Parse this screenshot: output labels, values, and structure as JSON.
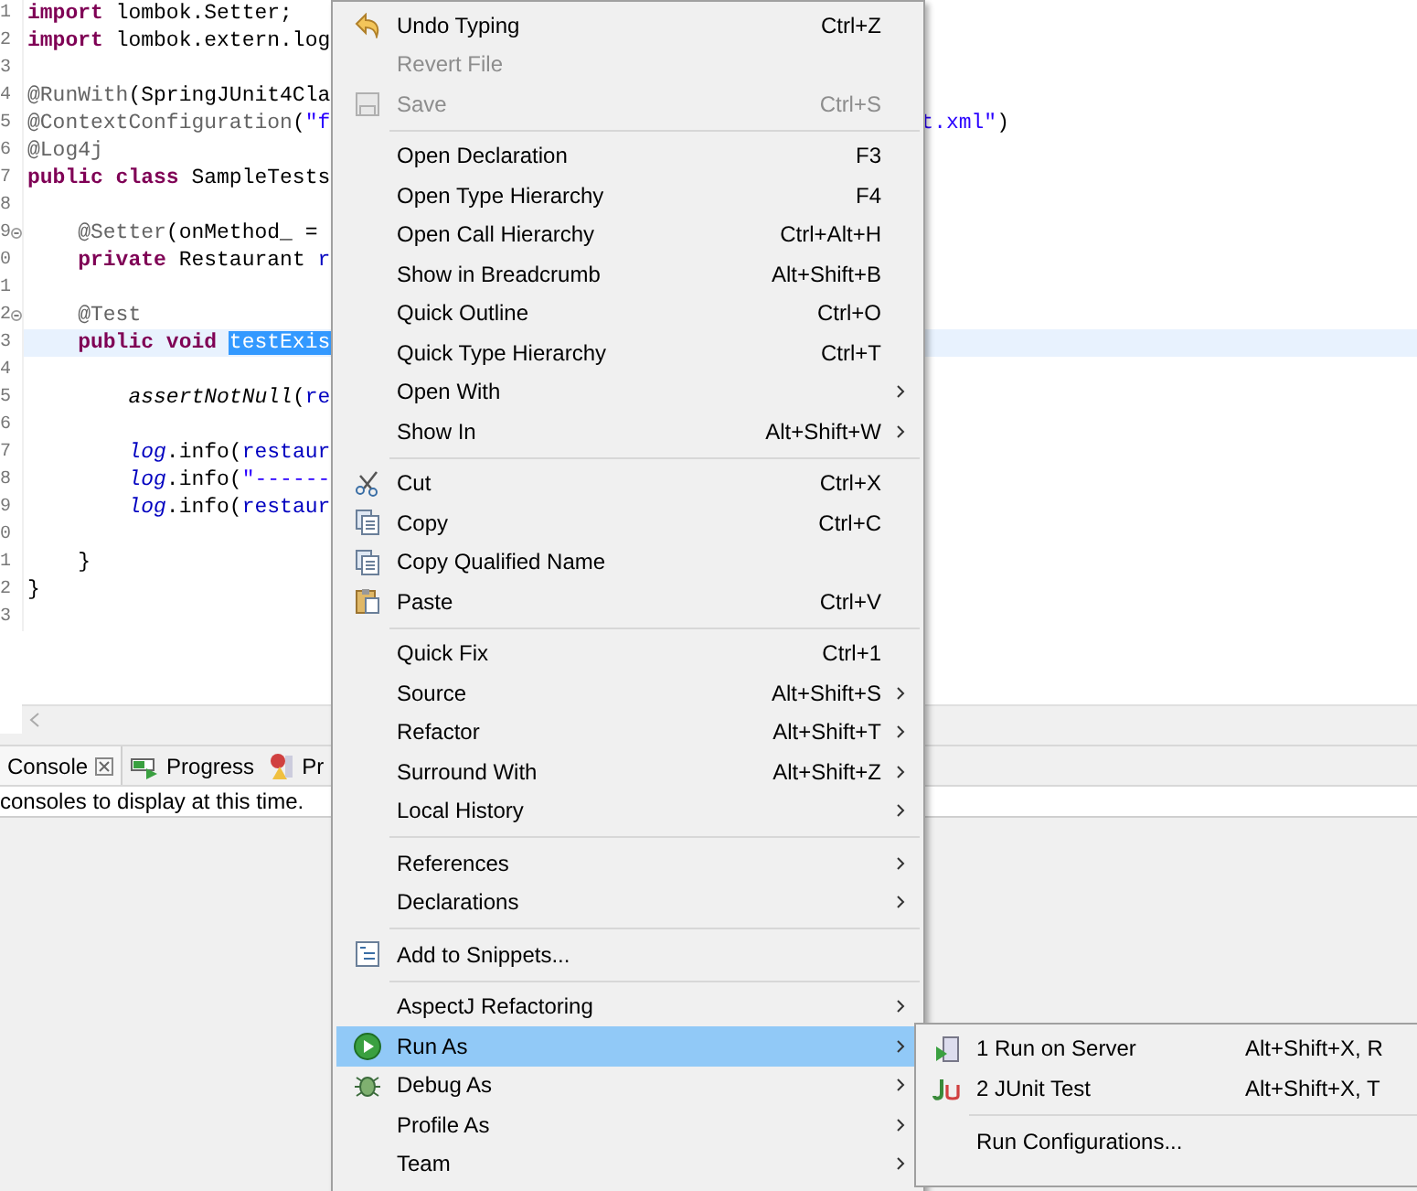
{
  "editor": {
    "lines": [
      {
        "number": "1",
        "fold": false,
        "current": false,
        "tokens": [
          {
            "text": "import ",
            "kind": "keyword"
          },
          {
            "text": "lombok.Setter;",
            "kind": "plain"
          }
        ]
      },
      {
        "number": "2",
        "fold": false,
        "current": false,
        "tokens": [
          {
            "text": "import ",
            "kind": "keyword"
          },
          {
            "text": "lombok.extern.log",
            "kind": "plain"
          }
        ]
      },
      {
        "number": "3",
        "fold": false,
        "current": false
      },
      {
        "number": "4",
        "fold": false,
        "current": false,
        "tokens": [
          {
            "text": "@RunWith",
            "kind": "annotation"
          },
          {
            "text": "(SpringJUnit4Cla",
            "kind": "plain"
          }
        ]
      },
      {
        "number": "5",
        "fold": false,
        "current": false,
        "tokens": [
          {
            "text": "@ContextConfiguration",
            "kind": "annotation"
          },
          {
            "text": "(",
            "kind": "plain"
          },
          {
            "text": "\"f",
            "kind": "string"
          }
        ],
        "tail": [
          {
            "text": "t.xml\"",
            "kind": "string"
          },
          {
            "text": ")",
            "kind": "plain"
          }
        ]
      },
      {
        "number": "6",
        "fold": false,
        "current": false,
        "tokens": [
          {
            "text": "@Log4j",
            "kind": "annotation"
          }
        ]
      },
      {
        "number": "7",
        "fold": false,
        "current": false,
        "tokens": [
          {
            "text": "public class ",
            "kind": "keyword"
          },
          {
            "text": "SampleTests",
            "kind": "plain"
          }
        ]
      },
      {
        "number": "8",
        "fold": false,
        "current": false
      },
      {
        "number": "9",
        "fold": true,
        "current": false,
        "tokens": [
          {
            "text": "    @Setter",
            "kind": "annotation"
          },
          {
            "text": "(onMethod_ =",
            "kind": "plain"
          }
        ]
      },
      {
        "number": "0",
        "fold": false,
        "current": false,
        "tokens": [
          {
            "text": "    private ",
            "kind": "keyword"
          },
          {
            "text": "Restaurant ",
            "kind": "plain"
          },
          {
            "text": "r",
            "kind": "field"
          }
        ]
      },
      {
        "number": "1",
        "fold": false,
        "current": false
      },
      {
        "number": "2",
        "fold": true,
        "current": false,
        "tokens": [
          {
            "text": "    @Test",
            "kind": "annotation"
          }
        ]
      },
      {
        "number": "3",
        "fold": false,
        "current": true,
        "tokens": [
          {
            "text": "    public void ",
            "kind": "keyword"
          },
          {
            "text": "testExis",
            "kind": "selection"
          }
        ]
      },
      {
        "number": "4",
        "fold": false,
        "current": false
      },
      {
        "number": "5",
        "fold": false,
        "current": false,
        "tokens": [
          {
            "text": "        assertNotNull",
            "kind": "static"
          },
          {
            "text": "(",
            "kind": "plain"
          },
          {
            "text": "re",
            "kind": "field"
          }
        ]
      },
      {
        "number": "6",
        "fold": false,
        "current": false
      },
      {
        "number": "7",
        "fold": false,
        "current": false,
        "tokens": [
          {
            "text": "        log",
            "kind": "staticfield"
          },
          {
            "text": ".info(",
            "kind": "plain"
          },
          {
            "text": "restaur",
            "kind": "field"
          }
        ]
      },
      {
        "number": "8",
        "fold": false,
        "current": false,
        "tokens": [
          {
            "text": "        log",
            "kind": "staticfield"
          },
          {
            "text": ".info(",
            "kind": "plain"
          },
          {
            "text": "\"------",
            "kind": "string"
          }
        ]
      },
      {
        "number": "9",
        "fold": false,
        "current": false,
        "tokens": [
          {
            "text": "        log",
            "kind": "staticfield"
          },
          {
            "text": ".info(",
            "kind": "plain"
          },
          {
            "text": "restaur",
            "kind": "field"
          }
        ]
      },
      {
        "number": "0",
        "fold": false,
        "current": false
      },
      {
        "number": "1",
        "fold": false,
        "current": false,
        "tokens": [
          {
            "text": "    }",
            "kind": "plain"
          }
        ]
      },
      {
        "number": "2",
        "fold": false,
        "current": false,
        "tokens": [
          {
            "text": "}",
            "kind": "plain"
          }
        ]
      },
      {
        "number": "3",
        "fold": false,
        "current": false
      }
    ]
  },
  "bottom_panel": {
    "tabs": [
      {
        "label": "Console",
        "selected": true
      },
      {
        "label": "Progress",
        "selected": false
      },
      {
        "label": "Pr",
        "selected": false
      }
    ],
    "message": "consoles to display at this time."
  },
  "context_menu": {
    "groups": [
      [
        {
          "label": "Undo Typing",
          "shortcut": "Ctrl+Z",
          "disabled": false,
          "submenu": false,
          "selected": false
        },
        {
          "label": "Revert File",
          "disabled": true,
          "submenu": false,
          "selected": false
        },
        {
          "label": "Save",
          "shortcut": "Ctrl+S",
          "disabled": true,
          "submenu": false,
          "selected": false
        }
      ],
      [
        {
          "label": "Open Declaration",
          "shortcut": "F3",
          "disabled": false,
          "submenu": false,
          "selected": false
        },
        {
          "label": "Open Type Hierarchy",
          "shortcut": "F4",
          "disabled": false,
          "submenu": false,
          "selected": false
        },
        {
          "label": "Open Call Hierarchy",
          "shortcut": "Ctrl+Alt+H",
          "disabled": false,
          "submenu": false,
          "selected": false
        },
        {
          "label": "Show in Breadcrumb",
          "shortcut": "Alt+Shift+B",
          "disabled": false,
          "submenu": false,
          "selected": false
        },
        {
          "label": "Quick Outline",
          "shortcut": "Ctrl+O",
          "disabled": false,
          "submenu": false,
          "selected": false
        },
        {
          "label": "Quick Type Hierarchy",
          "shortcut": "Ctrl+T",
          "disabled": false,
          "submenu": false,
          "selected": false
        },
        {
          "label": "Open With",
          "disabled": false,
          "submenu": true,
          "selected": false
        },
        {
          "label": "Show In",
          "shortcut": "Alt+Shift+W",
          "disabled": false,
          "submenu": true,
          "selected": false
        }
      ],
      [
        {
          "label": "Cut",
          "shortcut": "Ctrl+X",
          "disabled": false,
          "submenu": false,
          "selected": false
        },
        {
          "label": "Copy",
          "shortcut": "Ctrl+C",
          "disabled": false,
          "submenu": false,
          "selected": false
        },
        {
          "label": "Copy Qualified Name",
          "disabled": false,
          "submenu": false,
          "selected": false
        },
        {
          "label": "Paste",
          "shortcut": "Ctrl+V",
          "disabled": false,
          "submenu": false,
          "selected": false
        }
      ],
      [
        {
          "label": "Quick Fix",
          "shortcut": "Ctrl+1",
          "disabled": false,
          "submenu": false,
          "selected": false
        },
        {
          "label": "Source",
          "shortcut": "Alt+Shift+S",
          "disabled": false,
          "submenu": true,
          "selected": false
        },
        {
          "label": "Refactor",
          "shortcut": "Alt+Shift+T",
          "disabled": false,
          "submenu": true,
          "selected": false
        },
        {
          "label": "Surround With",
          "shortcut": "Alt+Shift+Z",
          "disabled": false,
          "submenu": true,
          "selected": false
        },
        {
          "label": "Local History",
          "disabled": false,
          "submenu": true,
          "selected": false
        }
      ],
      [
        {
          "label": "References",
          "disabled": false,
          "submenu": true,
          "selected": false
        },
        {
          "label": "Declarations",
          "disabled": false,
          "submenu": true,
          "selected": false
        }
      ],
      [
        {
          "label": "Add to Snippets...",
          "disabled": false,
          "submenu": false,
          "selected": false
        }
      ],
      [
        {
          "label": "AspectJ Refactoring",
          "disabled": false,
          "submenu": true,
          "selected": false
        },
        {
          "label": "Run As",
          "disabled": false,
          "submenu": true,
          "selected": true
        },
        {
          "label": "Debug As",
          "disabled": false,
          "submenu": true,
          "selected": false
        },
        {
          "label": "Profile As",
          "disabled": false,
          "submenu": true,
          "selected": false
        },
        {
          "label": "Team",
          "disabled": false,
          "submenu": true,
          "selected": false
        }
      ]
    ]
  },
  "submenu": {
    "groups": [
      [
        {
          "label": "1 Run on Server",
          "shortcut": "Alt+Shift+X, R"
        },
        {
          "label": "2 JUnit Test",
          "shortcut": "Alt+Shift+X, T"
        }
      ],
      [
        {
          "label": "Run Configurations..."
        }
      ]
    ]
  }
}
